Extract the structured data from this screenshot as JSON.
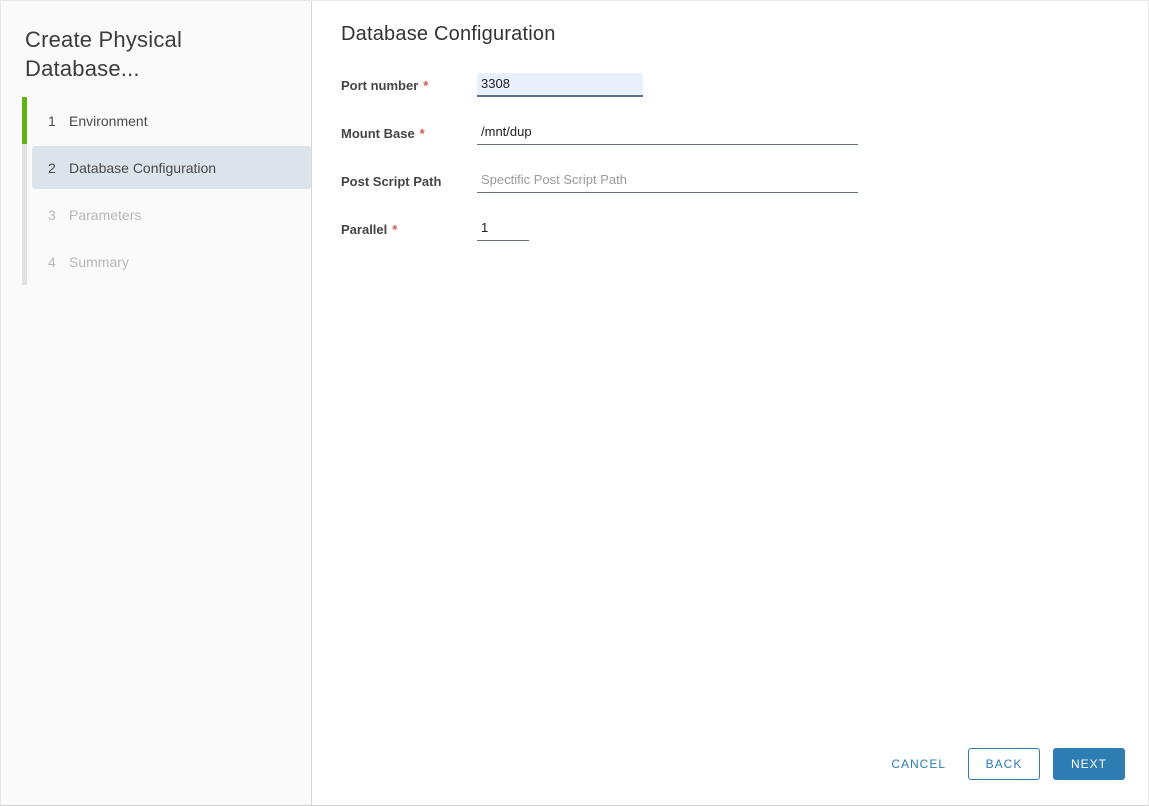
{
  "colors": {
    "primary_blue": "#2d7cb2",
    "accent_green": "#60b515",
    "step_highlight_bg": "#dbe3eb",
    "focused_input_bg": "#e8f0fe",
    "required_marker_red": "#d25b4b"
  },
  "sidebar": {
    "title": "Create Physical Database...",
    "steps": [
      {
        "number": "1",
        "label": "Environment",
        "state": "completed"
      },
      {
        "number": "2",
        "label": "Database Configuration",
        "state": "current"
      },
      {
        "number": "3",
        "label": "Parameters",
        "state": "disabled"
      },
      {
        "number": "4",
        "label": "Summary",
        "state": "disabled"
      }
    ]
  },
  "main": {
    "title": "Database Configuration",
    "required_marker": "*",
    "fields": [
      {
        "label": "Port number",
        "required": true,
        "value": "3308",
        "placeholder": ""
      },
      {
        "label": "Mount Base",
        "required": true,
        "value": "/mnt/dup",
        "placeholder": ""
      },
      {
        "label": "Post Script Path",
        "required": false,
        "value": "",
        "placeholder": "Spectific Post Script Path"
      },
      {
        "label": "Parallel",
        "required": true,
        "value": "1",
        "placeholder": ""
      }
    ]
  },
  "footer": {
    "cancel": "CANCEL",
    "back": "BACK",
    "next": "NEXT"
  }
}
